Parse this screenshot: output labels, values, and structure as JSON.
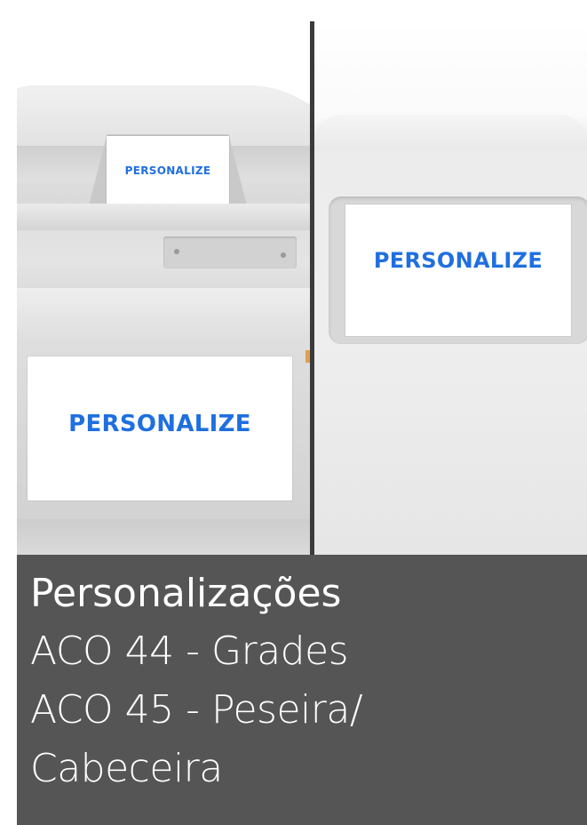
{
  "photo": {
    "left_label": "PERSONALIZE",
    "left_large_label": "PERSONALIZE",
    "right_label": "PERSONALIZE"
  },
  "caption": {
    "title": "Personalizações",
    "lines": [
      "ACO 44  - Grades",
      "ACO 45 - Peseira/",
      "Cabeceira"
    ]
  },
  "colors": {
    "label_text": "#1f6fe0",
    "caption_bg": "#555555",
    "divider": "#3b3b3b"
  }
}
